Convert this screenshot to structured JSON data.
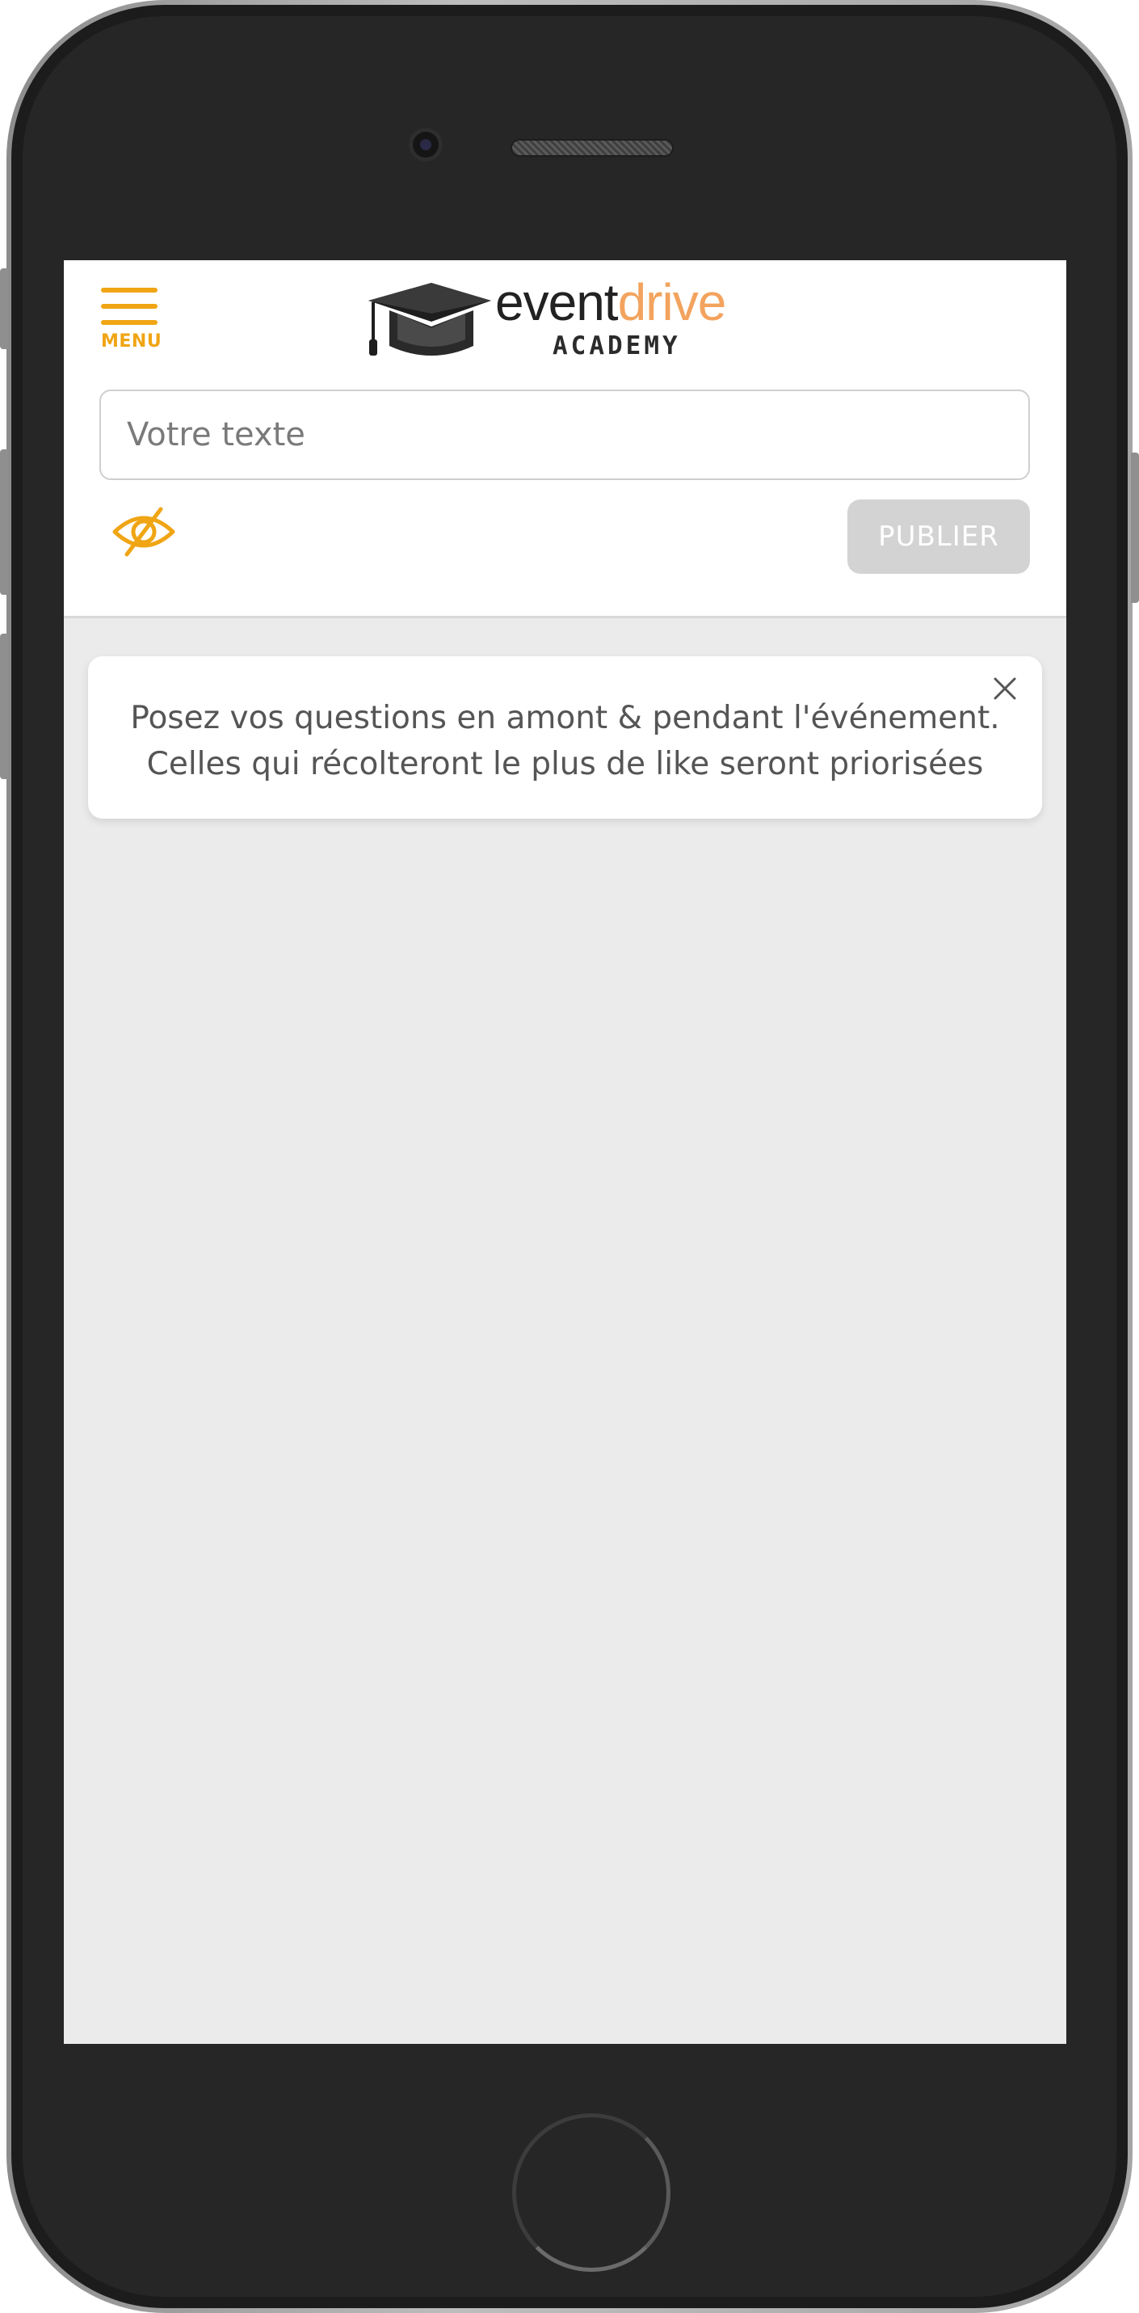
{
  "header": {
    "menu_label": "MENU",
    "logo": {
      "word_part1": "event",
      "word_part2": "drive",
      "subtitle": "ACADEMY"
    }
  },
  "composer": {
    "placeholder": "Votre texte",
    "value": "",
    "visibility_icon": "eye-slash-icon",
    "publish_label": "PUBLIER"
  },
  "notice": {
    "line1": "Posez vos questions en amont & pendant l'événement.",
    "line2": "Celles qui récolteront le plus de like seront priorisées",
    "close_icon": "close-icon"
  },
  "colors": {
    "accent": "#f0a514",
    "logo_drive": "#f3a35e",
    "screen_background": "#ebebeb",
    "button_disabled": "#d3d3d3",
    "text_muted": "#555555"
  }
}
